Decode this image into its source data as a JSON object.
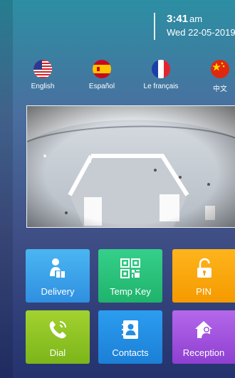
{
  "status": {
    "time": "3:41",
    "ampm": "am",
    "date": "Wed 22-05-2019"
  },
  "languages": [
    {
      "label": "English",
      "icon": "us-flag-icon"
    },
    {
      "label": "Español",
      "icon": "spain-flag-icon"
    },
    {
      "label": "Le français",
      "icon": "france-flag-icon"
    },
    {
      "label": "中文",
      "icon": "china-flag-icon"
    }
  ],
  "camera": {
    "icon": "camera-feed"
  },
  "tiles": [
    {
      "label": "Delivery",
      "icon": "delivery-person-icon",
      "color": "#3ea6ea"
    },
    {
      "label": "Temp Key",
      "icon": "qr-code-icon",
      "color": "#2cc27c"
    },
    {
      "label": "PIN",
      "icon": "unlock-icon",
      "color": "#f7a20a"
    },
    {
      "label": "Dial",
      "icon": "phone-call-icon",
      "color": "#90c324"
    },
    {
      "label": "Contacts",
      "icon": "contact-card-icon",
      "color": "#238ee3"
    },
    {
      "label": "Reception",
      "icon": "reception-house-icon",
      "color": "#a152de"
    }
  ]
}
